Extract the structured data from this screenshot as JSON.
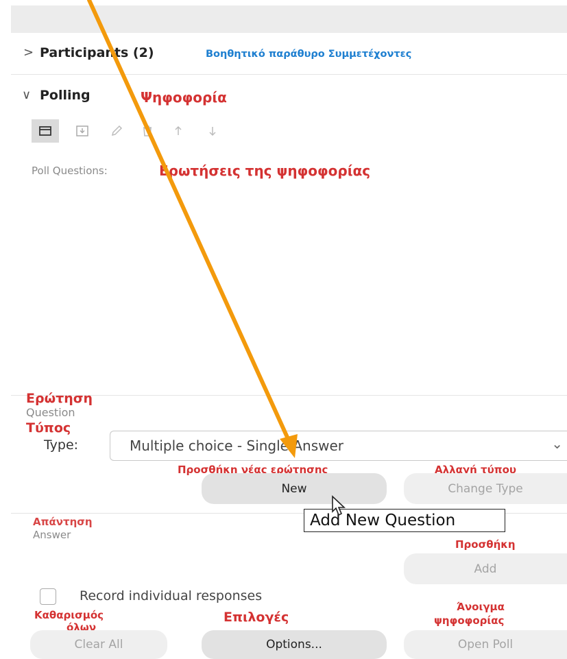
{
  "topbar": {},
  "participants": {
    "label": "Participants (2)",
    "note": "Βοηθητικό παράθυρο Συμμετέχοντες",
    "chevron": ">"
  },
  "polling": {
    "label": "Polling",
    "note": "Ψηφοφορία",
    "chevron": "∨"
  },
  "toolbar": {
    "icons": [
      "folder-open-icon",
      "save-icon",
      "edit-icon",
      "delete-icon",
      "move-up-icon",
      "move-down-icon"
    ]
  },
  "poll_questions": {
    "label": "Poll Questions:",
    "note": "Ερωτήσεις της ψηφοφορίας"
  },
  "question": {
    "note": "Ερώτηση",
    "label": "Question"
  },
  "type": {
    "note": "Τύπος",
    "label": "Type:",
    "value": "Multiple choice - Single Answer",
    "dropdown": "⌄"
  },
  "new_button": {
    "note": "Προσθήκη νέας ερώτησης",
    "label": "New"
  },
  "change_type_button": {
    "note": "Αλλαγή τύπου",
    "label": "Change Type"
  },
  "tooltip": {
    "text": "Add New Question"
  },
  "answer": {
    "note": "Απάντηση",
    "label": "Answer"
  },
  "add_button": {
    "note": "Προσθήκη",
    "label": "Add"
  },
  "record": {
    "label": "Record individual responses",
    "checked": false
  },
  "clear_all": {
    "note_line1": "Καθαρισμός",
    "note_line2": "όλων",
    "label": "Clear All"
  },
  "options": {
    "note": "Επιλογές",
    "label": "Options..."
  },
  "open_poll": {
    "note_line1": "Άνοιγμα",
    "note_line2": "ψηφοφορίας",
    "label": "Open Poll"
  },
  "colors": {
    "annotation_red": "#d43232",
    "annotation_blue": "#1e7fd0",
    "arrow_orange": "#f39a0c"
  }
}
